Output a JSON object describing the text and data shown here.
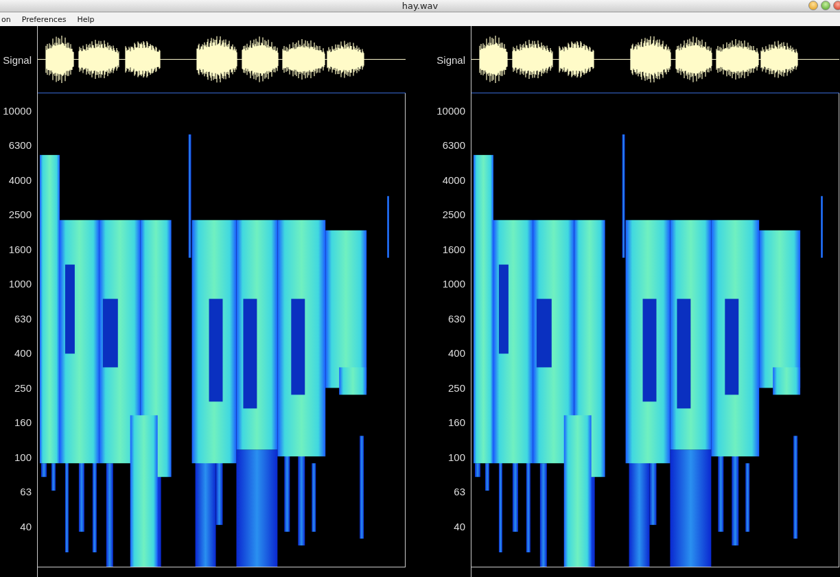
{
  "window": {
    "title": "hay.wav"
  },
  "menu": [
    {
      "label": "on"
    },
    {
      "label": "Preferences"
    },
    {
      "label": "Help"
    }
  ],
  "panels": [
    {
      "signal_label": "Signal",
      "frequency_labels": [
        "10000",
        "6300",
        "4000",
        "2500",
        "1600",
        "1000",
        "630",
        "400",
        "250",
        "160",
        "100",
        "63",
        "40"
      ]
    },
    {
      "signal_label": "Signal",
      "frequency_labels": [
        "10000",
        "6300",
        "4000",
        "2500",
        "1600",
        "1000",
        "630",
        "400",
        "250",
        "160",
        "100",
        "63",
        "40"
      ]
    }
  ]
}
